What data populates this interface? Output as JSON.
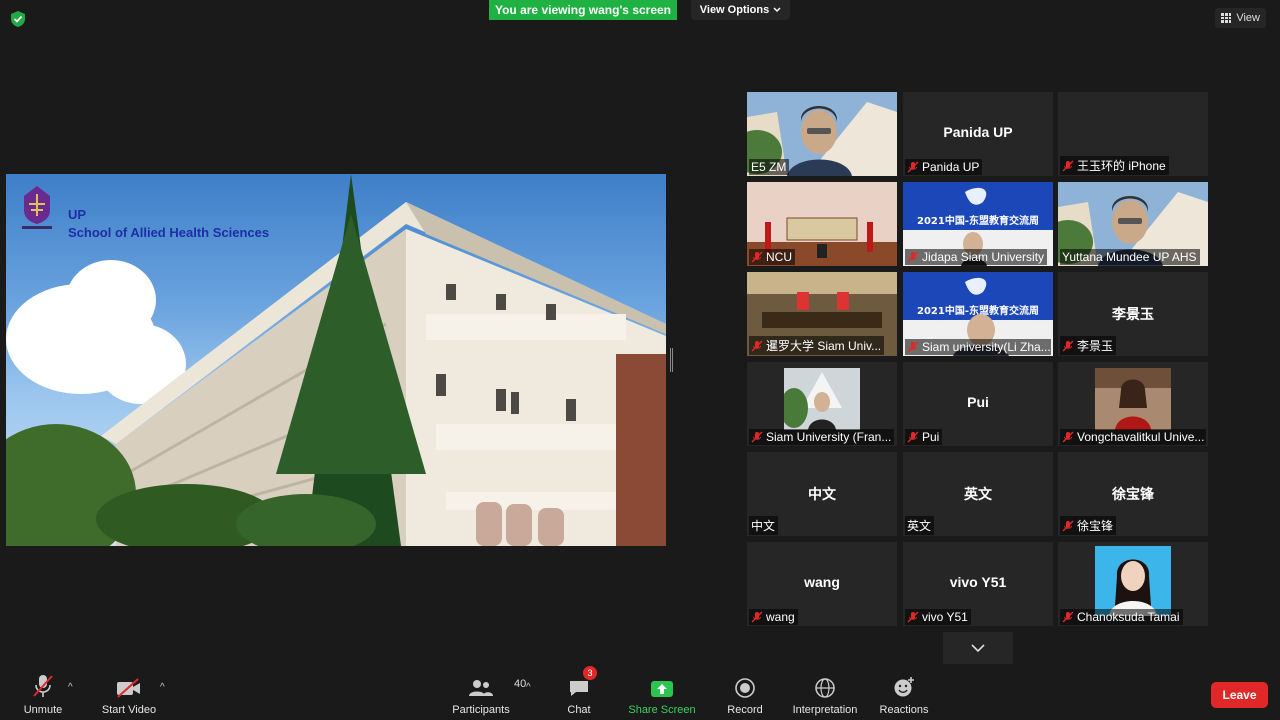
{
  "top": {
    "banner_text": "You are viewing wang's screen",
    "view_options_label": "View Options",
    "view_label": "View",
    "shield_icon": "shield-check-icon"
  },
  "shared_screen": {
    "line1": "UP",
    "line2": "School of Allied Health Sciences"
  },
  "gallery": {
    "tiles": [
      {
        "label": "E5 ZM",
        "center": "",
        "muted": false
      },
      {
        "label": "Panida UP",
        "center": "Panida UP",
        "muted": true
      },
      {
        "label": "王玉环的 iPhone",
        "center": "",
        "muted": true
      },
      {
        "label": "NCU",
        "center": "",
        "muted": true
      },
      {
        "label": "Jidapa Siam University",
        "center": "",
        "muted": true
      },
      {
        "label": "Yuttana Mundee UP AHS",
        "center": "",
        "muted": false
      },
      {
        "label": "暹罗大学 Siam Univ...",
        "center": "",
        "muted": true
      },
      {
        "label": "Siam university(Li Zha...",
        "center": "",
        "muted": true
      },
      {
        "label": "李景玉",
        "center": "李景玉",
        "muted": true
      },
      {
        "label": "Siam University (Fran...",
        "center": "",
        "muted": true
      },
      {
        "label": "Pui",
        "center": "Pui",
        "muted": true
      },
      {
        "label": "Vongchavalitkul Unive...",
        "center": "",
        "muted": true
      },
      {
        "label": "中文",
        "center": "中文",
        "muted": false
      },
      {
        "label": "英文",
        "center": "英文",
        "muted": false
      },
      {
        "label": "徐宝锋",
        "center": "徐宝锋",
        "muted": true
      },
      {
        "label": "wang",
        "center": "wang",
        "muted": true
      },
      {
        "label": "vivo Y51",
        "center": "vivo Y51",
        "muted": true
      },
      {
        "label": "Chanoksuda Tamai",
        "center": "",
        "muted": true
      }
    ],
    "event_banner": "2021中国-东盟教育交流周"
  },
  "toolbar": {
    "unmute": "Unmute",
    "start_video": "Start Video",
    "participants": "Participants",
    "participants_count": "40",
    "chat": "Chat",
    "chat_badge": "3",
    "share_screen": "Share Screen",
    "record": "Record",
    "interpretation": "Interpretation",
    "reactions": "Reactions",
    "leave": "Leave"
  },
  "colors": {
    "share_green": "#1fb141",
    "leave_red": "#e02828",
    "active_speaker": "#e8e84a",
    "mute_red": "#e02828"
  }
}
